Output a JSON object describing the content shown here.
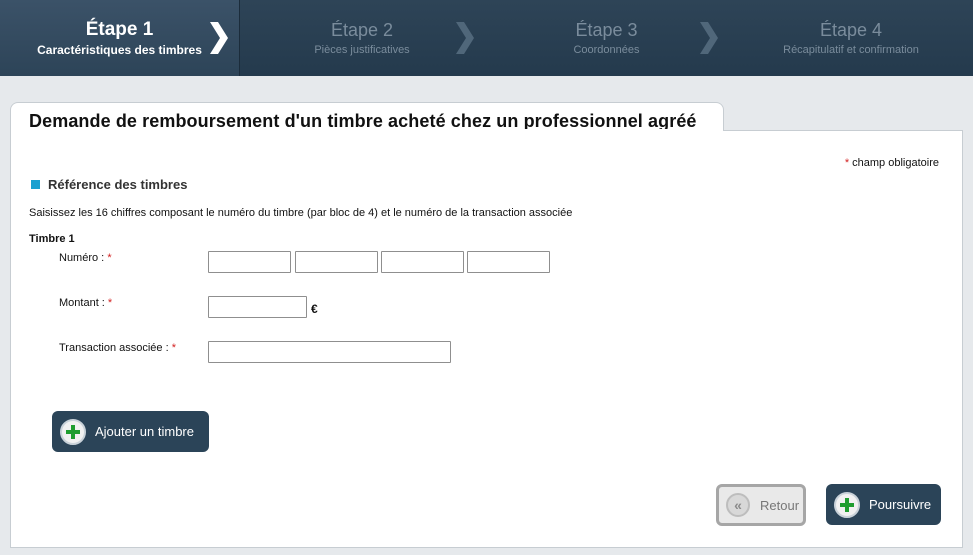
{
  "steps": [
    {
      "title": "Étape 1",
      "subtitle": "Caractéristiques des timbres",
      "active": true
    },
    {
      "title": "Étape 2",
      "subtitle": "Pièces justificatives",
      "active": false
    },
    {
      "title": "Étape 3",
      "subtitle": "Coordonnées",
      "active": false
    },
    {
      "title": "Étape 4",
      "subtitle": "Récapitulatif et confirmation",
      "active": false
    }
  ],
  "page": {
    "title": "Demande de remboursement d'un timbre acheté chez un professionnel agréé",
    "required_note": "champ obligatoire",
    "required_star": "*"
  },
  "section": {
    "title": "Référence des timbres",
    "instructions": "Saisissez les 16 chiffres composant le numéro du timbre (par bloc de 4) et le numéro de la transaction associée"
  },
  "timbre": {
    "heading": "Timbre 1",
    "numero_label": "Numéro :",
    "numero_values": [
      "",
      "",
      "",
      ""
    ],
    "montant_label": "Montant :",
    "montant_value": "",
    "currency": "€",
    "transaction_label": "Transaction associée :",
    "transaction_value": ""
  },
  "buttons": {
    "add_stamp": "Ajouter un timbre",
    "back": "Retour",
    "next": "Poursuivre"
  },
  "colors": {
    "header_bg": "#243a4d",
    "button_dark": "#2b4458",
    "accent_square": "#1aa0d0",
    "required_star": "#d21f1f",
    "plus_green": "#1f9d2f"
  }
}
